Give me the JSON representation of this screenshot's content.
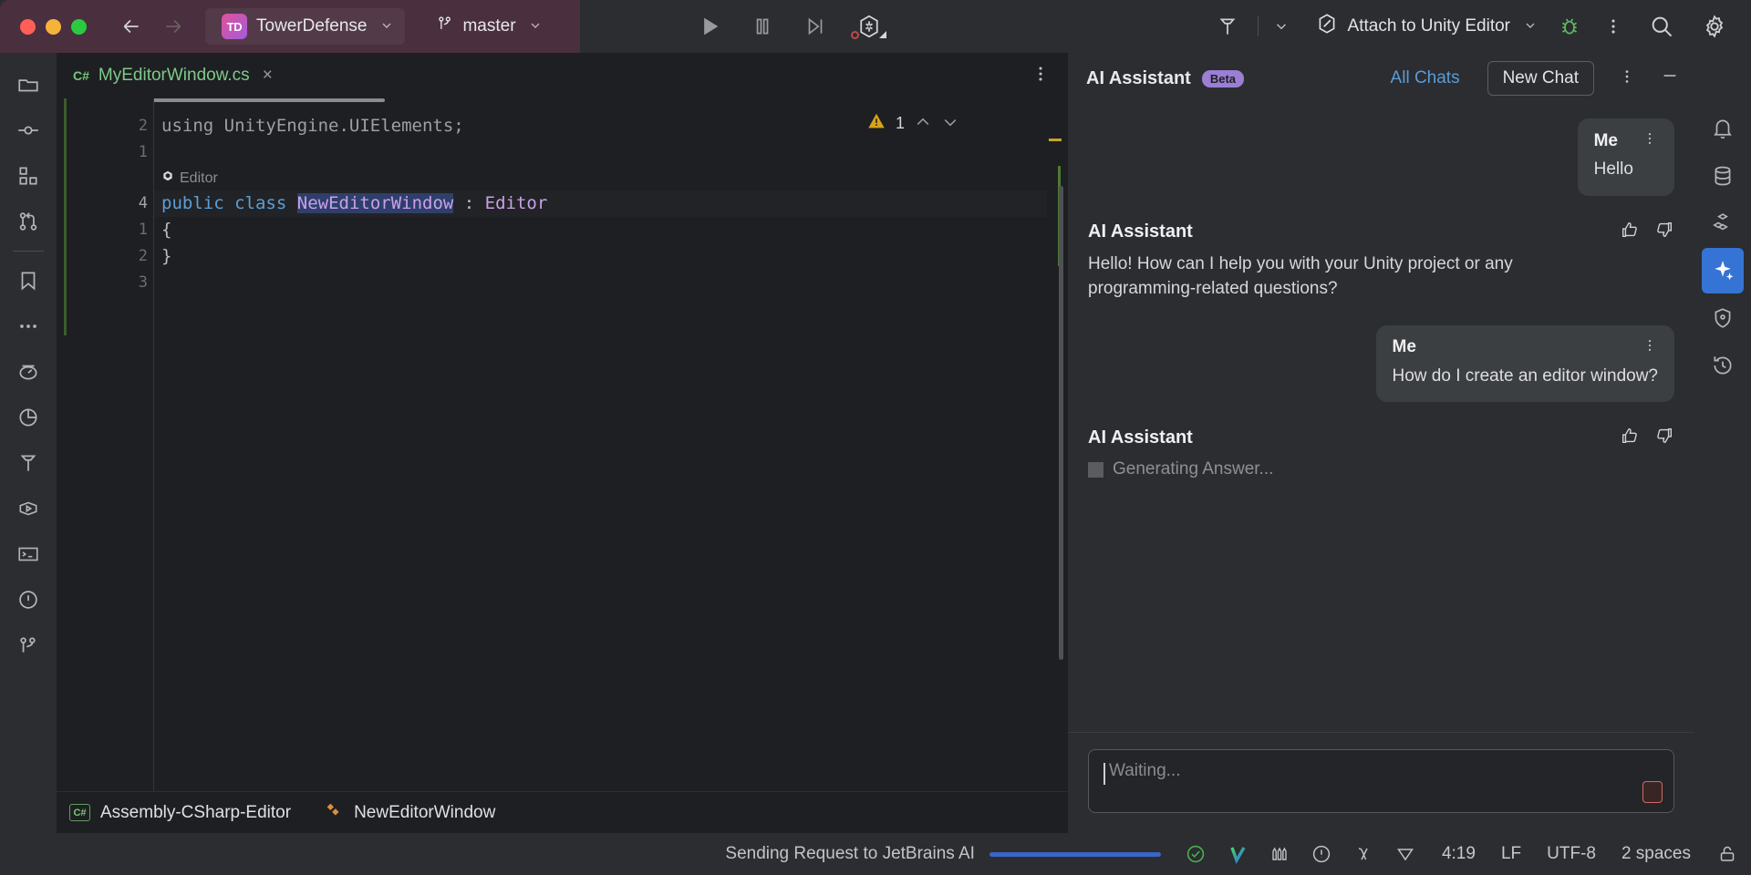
{
  "titlebar": {
    "project": {
      "badge": "TD",
      "name": "TowerDefense"
    },
    "branch": {
      "name": "master"
    },
    "run_config": {
      "label": "Attach to Unity Editor"
    },
    "icons": {
      "back": "back-arrow-icon",
      "forward": "forward-arrow-icon",
      "run": "run-icon",
      "pause": "pause-icon",
      "step": "step-over-icon",
      "unity": "unity-refresh-icon",
      "hammer": "build-hammer-icon",
      "debug": "debug-bug-icon",
      "more": "more-options-icon",
      "search": "search-icon",
      "settings": "gear-icon"
    }
  },
  "editor": {
    "tab": {
      "lang": "C#",
      "filename": "MyEditorWindow.cs",
      "close": "×"
    },
    "inspection": {
      "warning_count": "1"
    },
    "lines": [
      {
        "num": "2",
        "mark": "",
        "current": false
      },
      {
        "num": "1",
        "mark": "",
        "current": false
      },
      {
        "num": "",
        "mark": "",
        "current": false
      },
      {
        "num": "4",
        "mark": "io",
        "current": true
      },
      {
        "num": "1",
        "mark": "",
        "current": false
      },
      {
        "num": "2",
        "mark": "",
        "current": false
      },
      {
        "num": "3",
        "mark": "",
        "current": false
      }
    ],
    "code": {
      "line1": "using UnityEngine.UIElements;",
      "line2": "",
      "hint": "Editor",
      "decl_kw1": "public",
      "decl_kw2": "class",
      "decl_name": "NewEditorWindow",
      "decl_colon": " : ",
      "decl_base": "Editor",
      "open_brace": "{",
      "close_brace": "}"
    },
    "breadcrumb": {
      "assembly_badge": "C#",
      "assembly": "Assembly-CSharp-Editor",
      "symbol": "NewEditorWindow"
    }
  },
  "ai_panel": {
    "title": "AI Assistant",
    "badge": "Beta",
    "all_chats": "All Chats",
    "new_chat": "New Chat",
    "messages": [
      {
        "author": "Me",
        "text": "Hello",
        "role": "user"
      },
      {
        "author": "AI Assistant",
        "text": "Hello! How can I help you with your Unity project or any programming-related questions?",
        "role": "assistant"
      },
      {
        "author": "Me",
        "text": "How do I create an editor window?",
        "role": "user"
      },
      {
        "author": "AI Assistant",
        "text": "Generating Answer...",
        "role": "assistant"
      }
    ],
    "input": {
      "placeholder": "Waiting...",
      "value": ""
    },
    "stop_button": "stop-generation-button"
  },
  "left_rail": [
    {
      "name": "project-files-icon"
    },
    {
      "name": "commit-icon"
    },
    {
      "name": "structure-icon"
    },
    {
      "name": "pull-requests-icon"
    },
    {
      "name": "bookmarks-icon"
    },
    {
      "name": "more-tool-windows-icon"
    },
    {
      "name": "profiler-icon"
    },
    {
      "name": "coverage-icon"
    },
    {
      "name": "build-icon"
    },
    {
      "name": "run-tool-icon"
    },
    {
      "name": "terminal-icon"
    },
    {
      "name": "problems-icon"
    },
    {
      "name": "version-control-icon"
    }
  ],
  "right_rail": [
    {
      "name": "notifications-icon",
      "active": false
    },
    {
      "name": "database-icon",
      "active": false
    },
    {
      "name": "unity-packages-icon",
      "active": false
    },
    {
      "name": "ai-assistant-icon",
      "active": true
    },
    {
      "name": "security-shield-icon",
      "active": false
    },
    {
      "name": "history-icon",
      "active": false
    }
  ],
  "status_bar": {
    "progress_text": "Sending Request to JetBrains AI",
    "icons": [
      {
        "name": "inspection-ok-icon"
      },
      {
        "name": "resharper-icon"
      },
      {
        "name": "code-vision-icon"
      },
      {
        "name": "problems-status-icon"
      },
      {
        "name": "lambda-icon"
      },
      {
        "name": "filter-icon"
      }
    ],
    "caret_position": "4:19",
    "line_separator": "LF",
    "encoding": "UTF-8",
    "indent": "2 spaces",
    "lock": "read-only-lock-icon"
  },
  "colors": {
    "accent_blue": "#3574d4",
    "title_bar_project": "#4a2f3f",
    "beta_badge": "#9a7fd4",
    "warning": "#d6a419",
    "progress": "#3b66c8"
  }
}
